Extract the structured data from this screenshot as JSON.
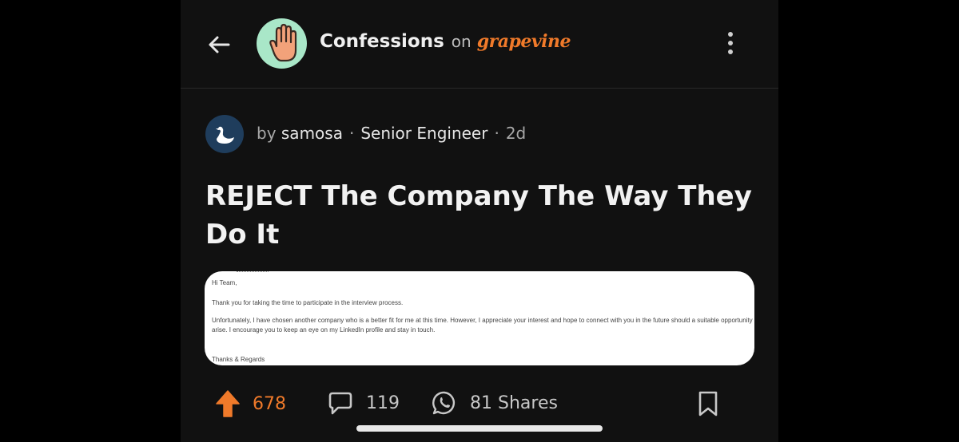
{
  "header": {
    "back_icon": "arrow-left-icon",
    "community_avatar_icon": "raised-hand-icon",
    "community_name": "Confessions",
    "on_word": "on",
    "brand_name": "grapevine",
    "menu_icon": "more-vertical-icon"
  },
  "post": {
    "author_prefix": "by",
    "author": "samosa",
    "separator": "·",
    "role": "Senior Engineer",
    "age": "2d",
    "title": "REJECT The Company The Way They Do It"
  },
  "email": {
    "greeting": "Hi Team,",
    "para1": "Thank you for taking the time to participate in the interview process.",
    "para2_line1": "Unfortunately, I have chosen another company who is a better fit for me at this time. However, I appreciate your interest and hope to connect with you in the future should a suitable opportunity",
    "para2_line2": "arise. I encourage you to keep an eye on my LinkedIn profile and stay in touch.",
    "signoff": "Thanks & Regards"
  },
  "actions": {
    "upvotes": "678",
    "comments": "119",
    "shares": "81 Shares"
  },
  "colors": {
    "accent": "#f07a2a",
    "background": "#111111",
    "avatar_bg": "#a9e7c8"
  }
}
